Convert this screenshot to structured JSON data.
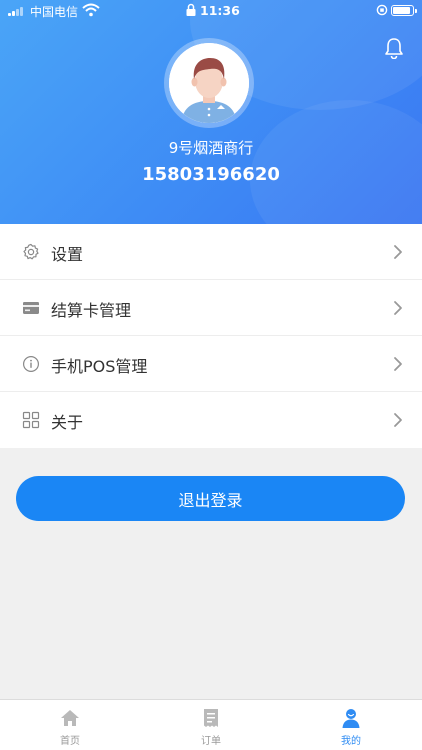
{
  "status_bar": {
    "carrier": "中国电信",
    "time": "11:36"
  },
  "profile": {
    "shop_name": "9号烟酒商行",
    "phone": "15803196620"
  },
  "menu": {
    "items": [
      {
        "label": "设置",
        "icon": "gear-icon"
      },
      {
        "label": "结算卡管理",
        "icon": "card-icon"
      },
      {
        "label": "手机POS管理",
        "icon": "info-icon"
      },
      {
        "label": "关于",
        "icon": "grid-icon"
      }
    ]
  },
  "logout_label": "退出登录",
  "tabbar": {
    "tabs": [
      {
        "label": "首页",
        "icon": "home-icon"
      },
      {
        "label": "订单",
        "icon": "order-icon"
      },
      {
        "label": "我的",
        "icon": "user-icon"
      }
    ],
    "active_index": 2
  },
  "colors": {
    "primary": "#1a86f5",
    "header_start": "#4aa5f7",
    "header_end": "#3a76f2",
    "tab_active": "#2f8cf3",
    "tab_inactive": "#9a9a9a"
  }
}
